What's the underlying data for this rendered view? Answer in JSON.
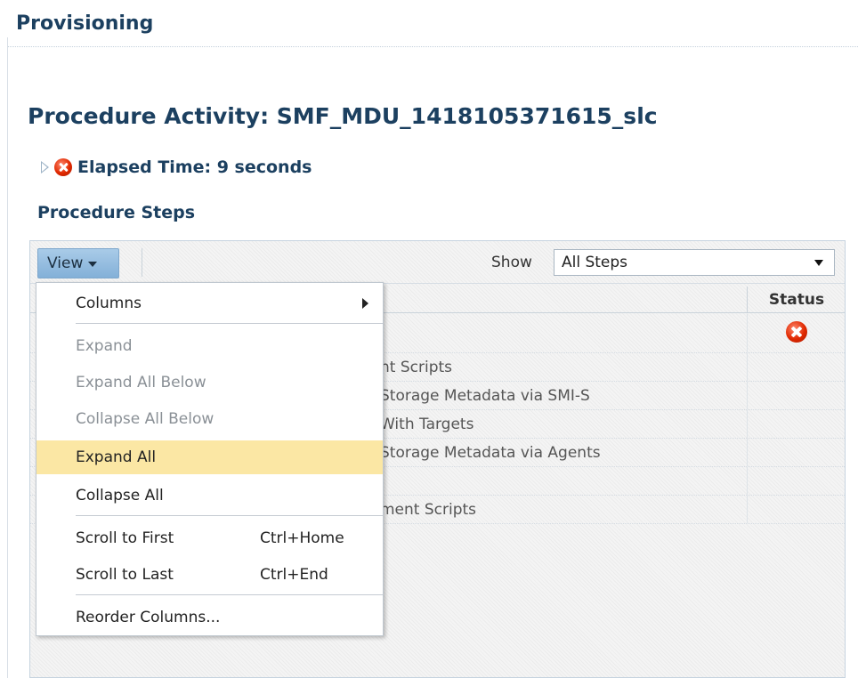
{
  "app_title": "Provisioning",
  "page_title": "Procedure Activity: SMF_MDU_1418105371615_slc",
  "elapsed": {
    "icon": "error-icon",
    "label": "Elapsed Time: 9 seconds"
  },
  "steps_title": "Procedure Steps",
  "toolbar": {
    "view_label": "View",
    "show_label": "Show",
    "show_value": "All Steps"
  },
  "table": {
    "status_header": "Status",
    "rows": [
      {
        "name": "",
        "status": "error"
      },
      {
        "name": "nt Scripts",
        "status": ""
      },
      {
        "name": "Storage Metadata via SMI-S",
        "status": ""
      },
      {
        "name": "With Targets",
        "status": ""
      },
      {
        "name": "Storage Metadata via Agents",
        "status": ""
      },
      {
        "name": "",
        "status": ""
      },
      {
        "name": "ment Scripts",
        "status": ""
      }
    ]
  },
  "view_menu": {
    "items": [
      {
        "label": "Columns",
        "submenu": true,
        "disabled": false
      },
      {
        "label": "Expand",
        "disabled": true
      },
      {
        "label": "Expand All Below",
        "disabled": true
      },
      {
        "label": "Collapse All Below",
        "disabled": true
      },
      {
        "label": "Expand All",
        "disabled": false,
        "highlighted": true
      },
      {
        "label": "Collapse All",
        "disabled": false
      },
      {
        "label": "Scroll to First",
        "accel": "Ctrl+Home",
        "disabled": false
      },
      {
        "label": "Scroll to Last",
        "accel": "Ctrl+End",
        "disabled": false
      },
      {
        "label": "Reorder Columns...",
        "disabled": false
      }
    ]
  },
  "colors": {
    "title": "#1c4060",
    "highlight": "#fbe7a4",
    "view_button": "#9cc2e4"
  }
}
